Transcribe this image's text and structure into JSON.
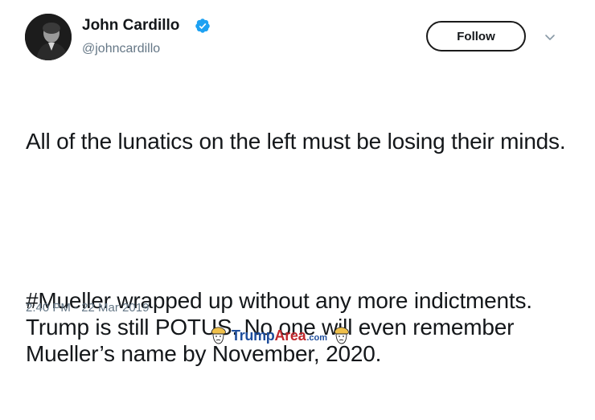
{
  "tweet": {
    "author": {
      "name": "John Cardillo",
      "handle": "@johncardillo",
      "verified": true
    },
    "follow_label": "Follow",
    "text_paragraphs": [
      "All of the lunatics on the left must be losing their minds.",
      "#Mueller wrapped up without any more indictments. Trump is still POTUS. No one will even remember Mueller’s name by November, 2020."
    ],
    "timestamp": "2:40 PM - 22 Mar 2019"
  },
  "watermark": {
    "brand_part1": "Trump",
    "brand_part2": "Area",
    "brand_suffix": ".com"
  },
  "colors": {
    "accent": "#1da1f2",
    "secondary_text": "#657786",
    "primary_text": "#14171a",
    "watermark_blue": "#1f4e9c",
    "watermark_red": "#c0282d"
  },
  "icons": {
    "verified": "verified-badge-icon",
    "menu": "chevron-down-icon"
  }
}
